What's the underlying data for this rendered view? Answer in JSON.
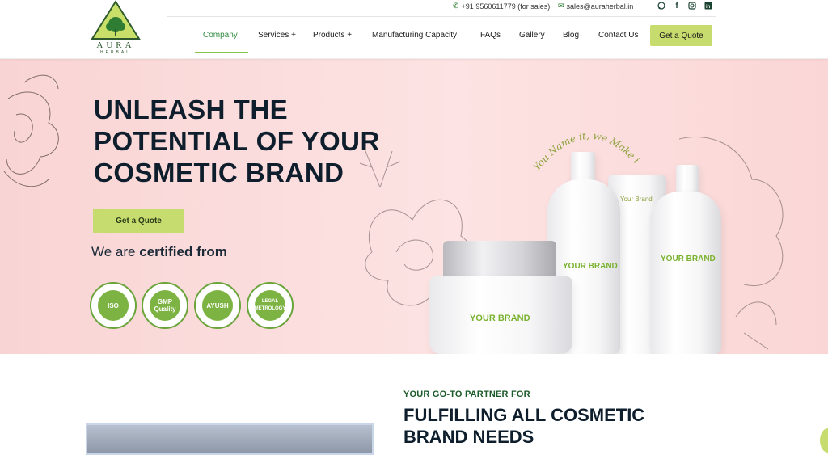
{
  "brand": {
    "name": "AURA",
    "sub": "HERBAL"
  },
  "topbar": {
    "phone": "+91 9560611779 (for sales)",
    "email": "sales@auraherbal.in",
    "social_icons": [
      "whatsapp-icon",
      "facebook-icon",
      "instagram-icon",
      "linkedin-icon"
    ]
  },
  "nav": {
    "items": [
      {
        "label": "Company",
        "active": true
      },
      {
        "label": "Services +"
      },
      {
        "label": "Products +"
      },
      {
        "label": "Manufacturing Capacity"
      },
      {
        "label": "FAQs"
      },
      {
        "label": "Gallery"
      },
      {
        "label": "Blog"
      },
      {
        "label": "Contact Us"
      }
    ],
    "cta": "Get a Quote"
  },
  "hero": {
    "title_lines": [
      "UNLEASH THE",
      "POTENTIAL OF YOUR",
      "COSMETIC BRAND"
    ],
    "cta": "Get a Quote",
    "certified_prefix": "We are",
    "certified_bold": "certified from",
    "badges": [
      {
        "label": "ISO"
      },
      {
        "label": "GMP Quality"
      },
      {
        "label": "AYUSH"
      },
      {
        "label": "LEGAL METROLOGY"
      }
    ],
    "tagline": "You Name it, we Make it",
    "products": {
      "jar": "YOUR BRAND",
      "bottle": "YOUR BRAND",
      "tube": "Your Brand",
      "pump": "YOUR BRAND"
    }
  },
  "lower": {
    "eyebrow": "YOUR GO-TO PARTNER FOR",
    "title_lines": [
      "FULFILLING ALL COSMETIC",
      "BRAND NEEDS"
    ]
  },
  "colors": {
    "accent_green": "#c6dc6e",
    "brand_green": "#2e8b3e",
    "hero_pink": "#fbd9d9",
    "dark_navy": "#0e1e2c"
  }
}
